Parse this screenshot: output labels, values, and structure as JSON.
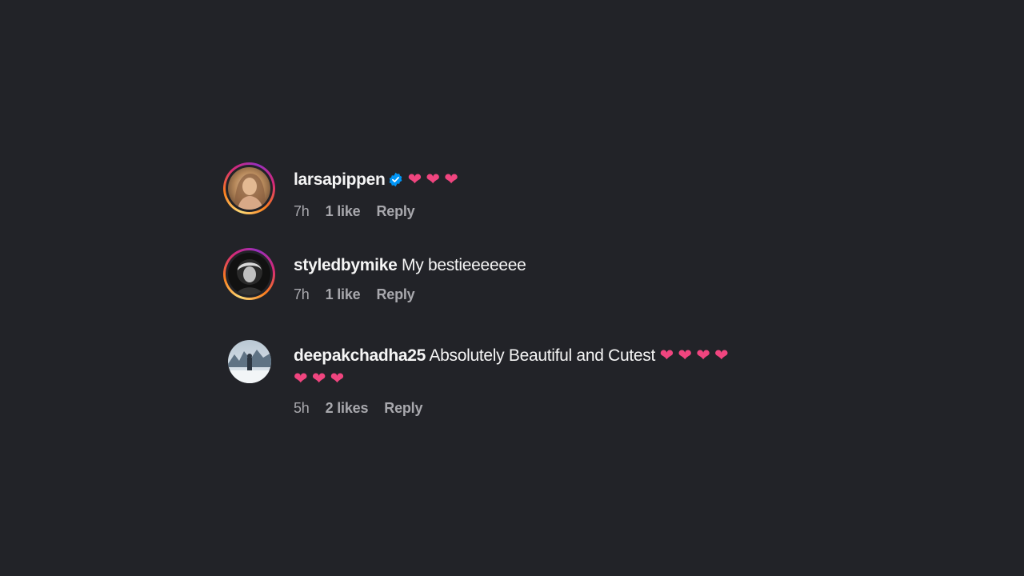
{
  "comments": [
    {
      "username": "larsapippen",
      "verified": true,
      "text": "",
      "hearts": "❤ ❤ ❤",
      "time": "7h",
      "likes": "1 like",
      "reply": "Reply",
      "story_ring": true
    },
    {
      "username": "styledbymike",
      "verified": false,
      "text": "My bestieeeeeee",
      "time": "7h",
      "likes": "1 like",
      "reply": "Reply",
      "story_ring": true
    },
    {
      "username": "deepakchadha25",
      "verified": false,
      "text": "Absolutely Beautiful and Cutest",
      "hearts_line1": "❤ ❤ ❤ ❤",
      "hearts_line2": "❤ ❤ ❤",
      "time": "5h",
      "likes": "2 likes",
      "reply": "Reply",
      "story_ring": false
    }
  ],
  "colors": {
    "background": "#222328",
    "heart": "#f0457f",
    "verified": "#0095f6",
    "meta": "#a8a8ad"
  }
}
